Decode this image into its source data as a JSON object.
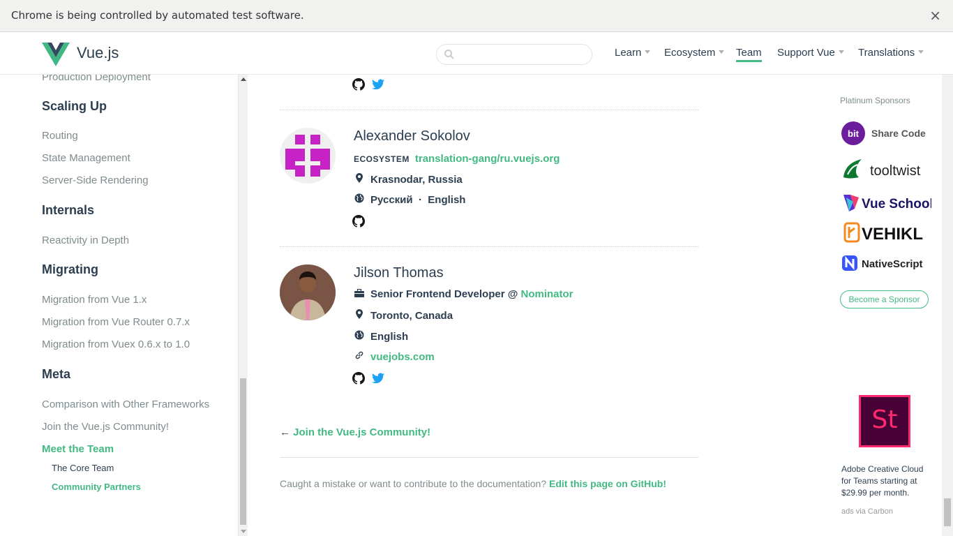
{
  "automation_bar": {
    "message": "Chrome is being controlled by automated test software.",
    "close": "×"
  },
  "header": {
    "logo_text": "Vue.js",
    "search": {
      "placeholder": ""
    },
    "nav": [
      {
        "label": "Learn",
        "dropdown": true
      },
      {
        "label": "Ecosystem",
        "dropdown": true
      },
      {
        "label": "Team",
        "dropdown": false,
        "active": true
      },
      {
        "label": "Support Vue",
        "dropdown": true
      },
      {
        "label": "Translations",
        "dropdown": true
      }
    ]
  },
  "sidebar": {
    "top_partial": "Production Deployment",
    "sections": [
      {
        "title": "Scaling Up",
        "items": [
          "Routing",
          "State Management",
          "Server-Side Rendering"
        ]
      },
      {
        "title": "Internals",
        "items": [
          "Reactivity in Depth"
        ]
      },
      {
        "title": "Migrating",
        "items": [
          "Migration from Vue 1.x",
          "Migration from Vue Router 0.7.x",
          "Migration from Vuex 0.6.x to 1.0"
        ]
      },
      {
        "title": "Meta",
        "items": [
          "Comparison with Other Frameworks",
          "Join the Vue.js Community!",
          "Meet the Team"
        ]
      }
    ],
    "sub_items": [
      "The Core Team",
      "Community Partners"
    ]
  },
  "members": [
    {
      "name": "Alexander Sokolov",
      "tag": "ECOSYSTEM",
      "project": "translation-gang/ru.vuejs.org",
      "location": "Krasnodar, Russia",
      "languages": [
        "Русский",
        "English"
      ],
      "lang_sep": "·"
    },
    {
      "name": "Jilson Thomas",
      "role": "Senior Frontend Developer @ ",
      "company": "Nominator",
      "location": "Toronto, Canada",
      "languages": [
        "English"
      ],
      "website": "vuejobs.com"
    }
  ],
  "nav_prev": {
    "arrow": "←",
    "label": "Join the Vue.js Community!"
  },
  "footer": {
    "text": "Caught a mistake or want to contribute to the documentation? ",
    "link": "Edit this page on GitHub!"
  },
  "sponsors": {
    "title": "Platinum Sponsors",
    "items": [
      "Share Code",
      "tooltwist",
      "Vue School",
      "VEHIKL",
      "NativeScript"
    ],
    "bit_label": "bit",
    "become": "Become a Sponsor"
  },
  "ad": {
    "logo": "St",
    "text": "Adobe Creative Cloud for Teams starting at $29.99 per month.",
    "via": "ads via Carbon"
  },
  "colors": {
    "accent": "#42b983",
    "text": "#2c3e50",
    "muted": "#7f8c8d",
    "twitter": "#1da1f2"
  }
}
